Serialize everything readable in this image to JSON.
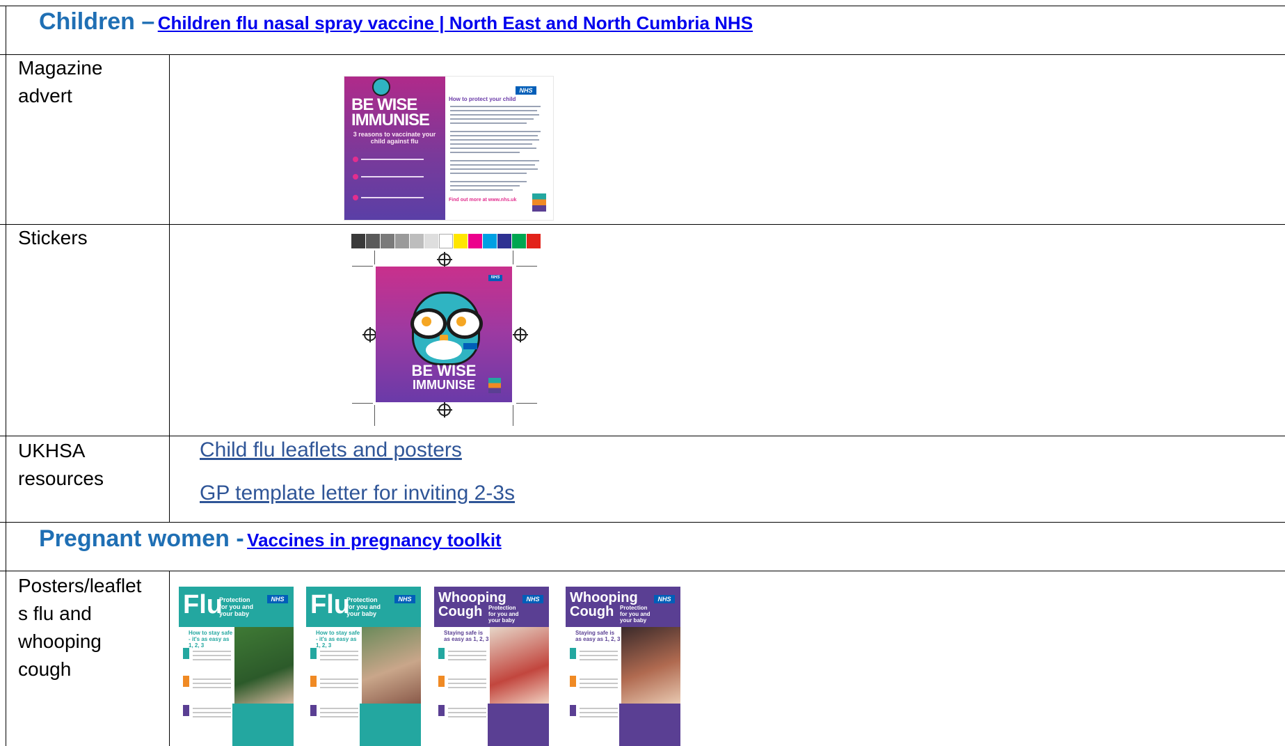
{
  "sections": [
    {
      "heading": "Children –",
      "link": "Children flu nasal spray vaccine | North East and North Cumbria NHS",
      "rows": [
        {
          "label": "Magazine advert",
          "advert": {
            "title_line1": "BE WISE",
            "title_line2": "IMMUNISE",
            "subtitle": "3 reasons to vaccinate your child against flu",
            "right_heading": "How to protect your child",
            "nhs_logo": "NHS",
            "footer": "Find out more at www.nhs.uk"
          }
        },
        {
          "label": "Stickers",
          "sticker": {
            "title_line1": "BE WISE",
            "title_line2": "IMMUNISE",
            "nhs_logo": "NHS",
            "owl_icon": "owl-with-glasses-icon"
          }
        },
        {
          "label": "UKHSA resources",
          "links": [
            "Child flu leaflets and posters",
            "GP template letter for inviting 2-3s"
          ]
        }
      ]
    },
    {
      "heading": "Pregnant women -",
      "link": "Vaccines in pregnancy toolkit",
      "rows": [
        {
          "label": "Posters/leaflets flu and whooping cough",
          "label_lines": [
            "Posters/leaflet",
            "s flu and",
            "whooping",
            "cough"
          ],
          "posters": [
            {
              "title": "Flu",
              "sub": "Protection for you and your baby",
              "nhs": "NHS",
              "tagline": "How to stay safe - it's as easy as 1, 2, 3",
              "top_color": "#23a7a0"
            },
            {
              "title": "Flu",
              "sub": "Protection for you and your baby",
              "nhs": "NHS",
              "tagline": "How to stay safe - it's as easy as 1, 2, 3",
              "top_color": "#23a7a0"
            },
            {
              "title": "Whooping Cough",
              "sub": "Protection for you and your baby",
              "nhs": "NHS",
              "tagline": "Staying safe is as easy as 1, 2, 3",
              "top_color": "#5a3f93"
            },
            {
              "title": "Whooping Cough",
              "sub": "Protection for you and your baby",
              "nhs": "NHS",
              "tagline": "Staying safe is as easy as 1, 2, 3",
              "top_color": "#5a3f93"
            }
          ]
        }
      ]
    }
  ],
  "colors": {
    "heading_blue": "#1f6fb4",
    "link_blue": "#0000ee",
    "resource_link": "#2f5597",
    "advert_magenta": "#b02a8a",
    "advert_purple": "#5a3fa6"
  }
}
